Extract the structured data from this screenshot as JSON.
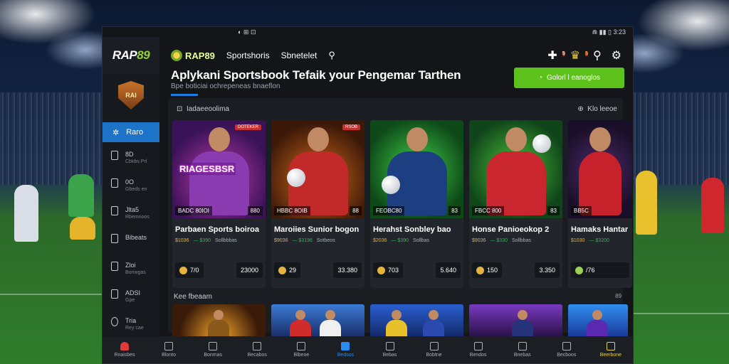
{
  "status_bar": {
    "left_icons": "◐ ⊞ ⊡",
    "right": "⋒ ▮▮ ▯ 3:23"
  },
  "brand": {
    "name_a": "RAP",
    "name_b": "89"
  },
  "top_nav": {
    "logo_text": "RAP89",
    "items": [
      "Sportshoris",
      "Sbnetelet"
    ]
  },
  "header": {
    "title": "Aplykani Sportsbook Tefaik your Pengemar Tarthen",
    "subtitle": "Bpe boticiai ochrepeneas bnaeflon",
    "cta_label": "Golorl l eanoglos"
  },
  "badges": {
    "puzzle": "5",
    "trophy": "5"
  },
  "sidebar": {
    "logo_text": "RAI",
    "active_label": "Raro",
    "items": [
      {
        "label": "8D",
        "sub": "Cbkbs Prl"
      },
      {
        "label": "0O",
        "sub": "Gbeds en"
      },
      {
        "label": "Jlta5",
        "sub": "Rbemnoos"
      },
      {
        "label": "Bibeats",
        "sub": ""
      },
      {
        "label": "Zloi",
        "sub": "Boriwgas"
      },
      {
        "label": "ADSI",
        "sub": "Gpe"
      },
      {
        "label": "Tria",
        "sub": "Rey cae"
      }
    ]
  },
  "panel": {
    "left_label": "Iadaeeoolima",
    "right_label": "Klo leeoe"
  },
  "cards": [
    {
      "img_text": "RIAGESBSR",
      "badge": "OOTEKER",
      "tag": "BADC 80IOI",
      "tag2": "880",
      "title": "Parbaen Sports boiroa",
      "price": "$1036",
      "disc": "— $390",
      "extra": "Sollbbbas",
      "chip1": "7/0",
      "chip2": "23000"
    },
    {
      "img_text": "",
      "badge": "RSOB",
      "tag": "HBBC 8OIB",
      "tag2": "88",
      "title": "Maroiies Sunior bogon",
      "price": "$9036",
      "disc": "— $3196",
      "extra": "Sotbeos",
      "chip1": "29",
      "chip2": "33.380"
    },
    {
      "img_text": "",
      "badge": "",
      "tag": "FEOBC80",
      "tag2": "83",
      "title": "Herahst Sonbley bao",
      "price": "$2036",
      "disc": "— $390",
      "extra": "Sollbas",
      "chip1": "703",
      "chip2": "5.640"
    },
    {
      "img_text": "",
      "badge": "",
      "tag": "FBCC 800",
      "tag2": "83",
      "title": "Honse Panioeokop 2",
      "price": "$9036",
      "disc": "— $330",
      "extra": "Sollbbas",
      "chip1": "150",
      "chip2": "3.350"
    },
    {
      "img_text": "",
      "badge": "",
      "tag": "BB5C",
      "tag2": "",
      "title": "Hamaks Hantar",
      "price": "$1030",
      "disc": "— $3200",
      "extra": "",
      "chip1": "/76",
      "chip2": ""
    }
  ],
  "section2": {
    "title": "Kee fbeaam",
    "count": "89"
  },
  "bottom_nav": [
    "Rnaisbes",
    "Blonto",
    "Bonmas",
    "Becabos",
    "Blbeoe",
    "Bedsos",
    "Bebas",
    "Bobtne",
    "Bendos",
    "Bnebas",
    "Becboos",
    "Beerbone"
  ]
}
